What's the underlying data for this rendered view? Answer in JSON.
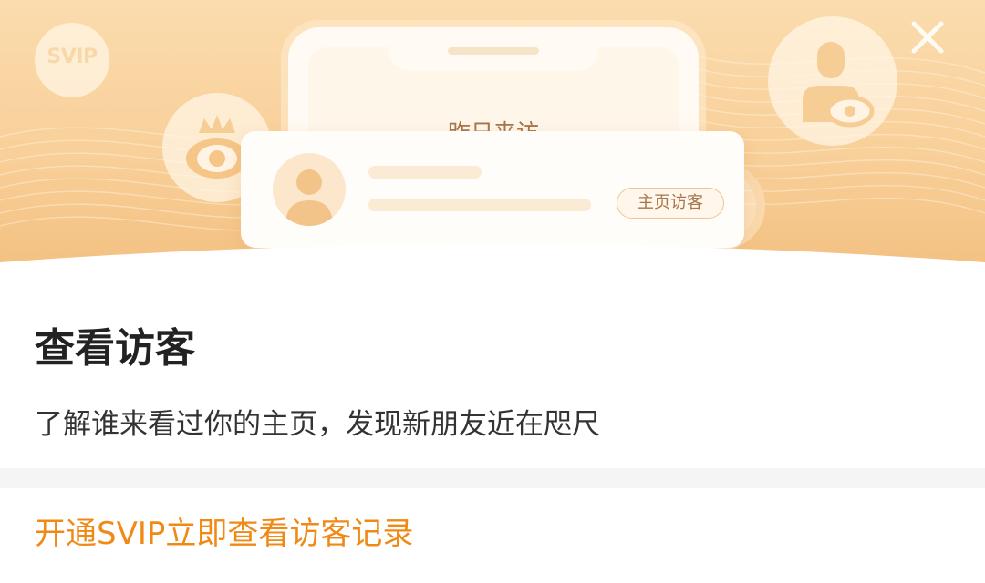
{
  "hero": {
    "svip_badge_text": "SVIP",
    "phone_title": "昨日来访",
    "card_tag": "主页访客",
    "icons": {
      "close": "close-icon",
      "svip": "svip-badge-icon",
      "eye": "crowned-eye-icon",
      "visitor": "visitor-eye-icon",
      "avatar": "avatar-icon",
      "magnifier": "magnifier-icon"
    }
  },
  "content": {
    "title": "查看访客",
    "subtitle": "了解谁来看过你的主页，发现新朋友近在咫尺",
    "cta_label": "开通SVIP立即查看访客记录"
  },
  "colors": {
    "accent": "#ef8a17",
    "hero_light": "#fbdcae",
    "hero_dark": "#f2bd7c",
    "title": "#222222",
    "divider": "#f5f5f5"
  }
}
